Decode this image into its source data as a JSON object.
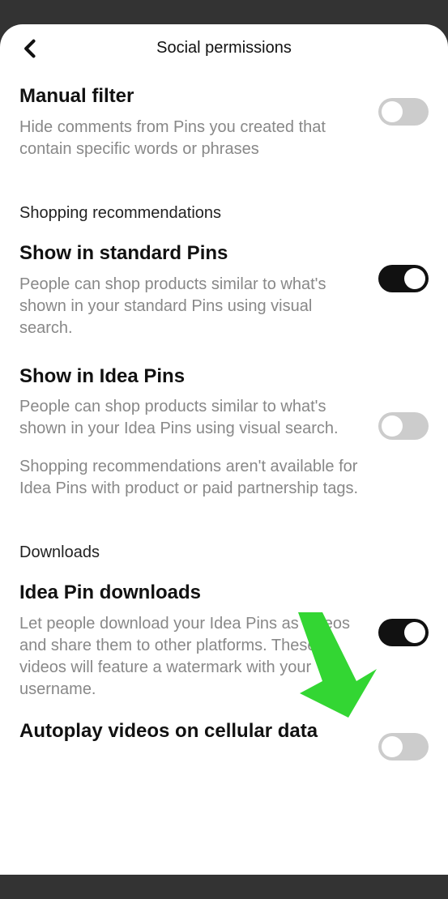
{
  "header": {
    "title": "Social permissions"
  },
  "sections": {
    "manual_filter": {
      "title": "Manual filter",
      "desc": "Hide comments from Pins you created that contain specific words or phrases",
      "toggle": false
    },
    "shopping_header": "Shopping recommendations",
    "standard_pins": {
      "title": "Show in standard Pins",
      "desc": "People can shop products similar to what's shown in your standard Pins using visual search.",
      "toggle": true
    },
    "idea_pins": {
      "title": "Show in Idea Pins",
      "desc": "People can shop products similar to what's shown in your Idea Pins using visual search.",
      "note": "Shopping recommendations aren't available for Idea Pins with product or paid partnership tags.",
      "toggle": false
    },
    "downloads_header": "Downloads",
    "idea_downloads": {
      "title": "Idea Pin downloads",
      "desc": "Let people download your Idea Pins as videos and share them to other platforms. These videos will feature a watermark with your username.",
      "toggle": true
    },
    "autoplay": {
      "title": "Autoplay videos on cellular data",
      "toggle": false
    }
  },
  "annotation": {
    "arrow_color": "#33d633"
  }
}
